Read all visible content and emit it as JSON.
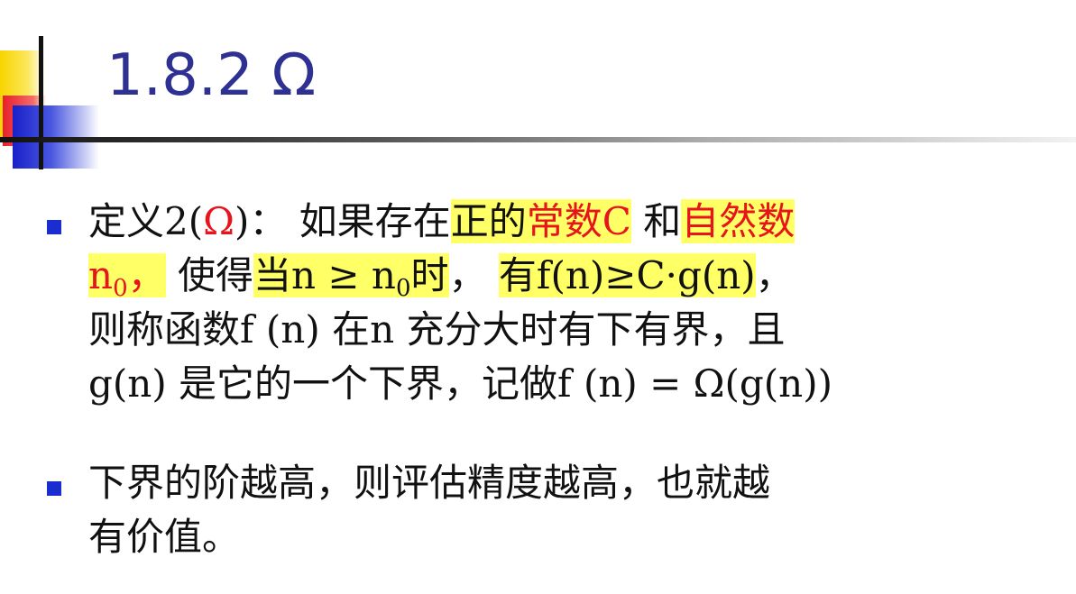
{
  "title": "1.8.2 Ω",
  "bullet1": {
    "l1_a": "定义2(",
    "l1_omega": "Ω",
    "l1_b": ")：  如果存在",
    "l1_hl1": "正的",
    "l1_red1": "常数C",
    "l1_c": " 和",
    "l1_red2": "自然数",
    "l2_n": "n",
    "l2_sub0": "0",
    "l2_comma": "，",
    "l2_b": "  使得",
    "l2_hl_a": "当n ≥ n",
    "l2_hl_sub": "0",
    "l2_hl_b": "时",
    "l2_c": "，  ",
    "l2_hl2": "有f(n)≥C·g(n)",
    "l2_d": "，",
    "l3": "则称函数f (n) 在n 充分大时有下有界，且",
    "l4": "g(n) 是它的一个下界，记做f (n) = Ω(g(n))"
  },
  "bullet2": {
    "l1": "下界的阶越高，则评估精度越高，也就越",
    "l2": "有价值。"
  },
  "colors": {
    "title": "#2e3192",
    "highlight": "#ffff66",
    "red": "#e8141c",
    "bullet": "#1a2ecf"
  }
}
